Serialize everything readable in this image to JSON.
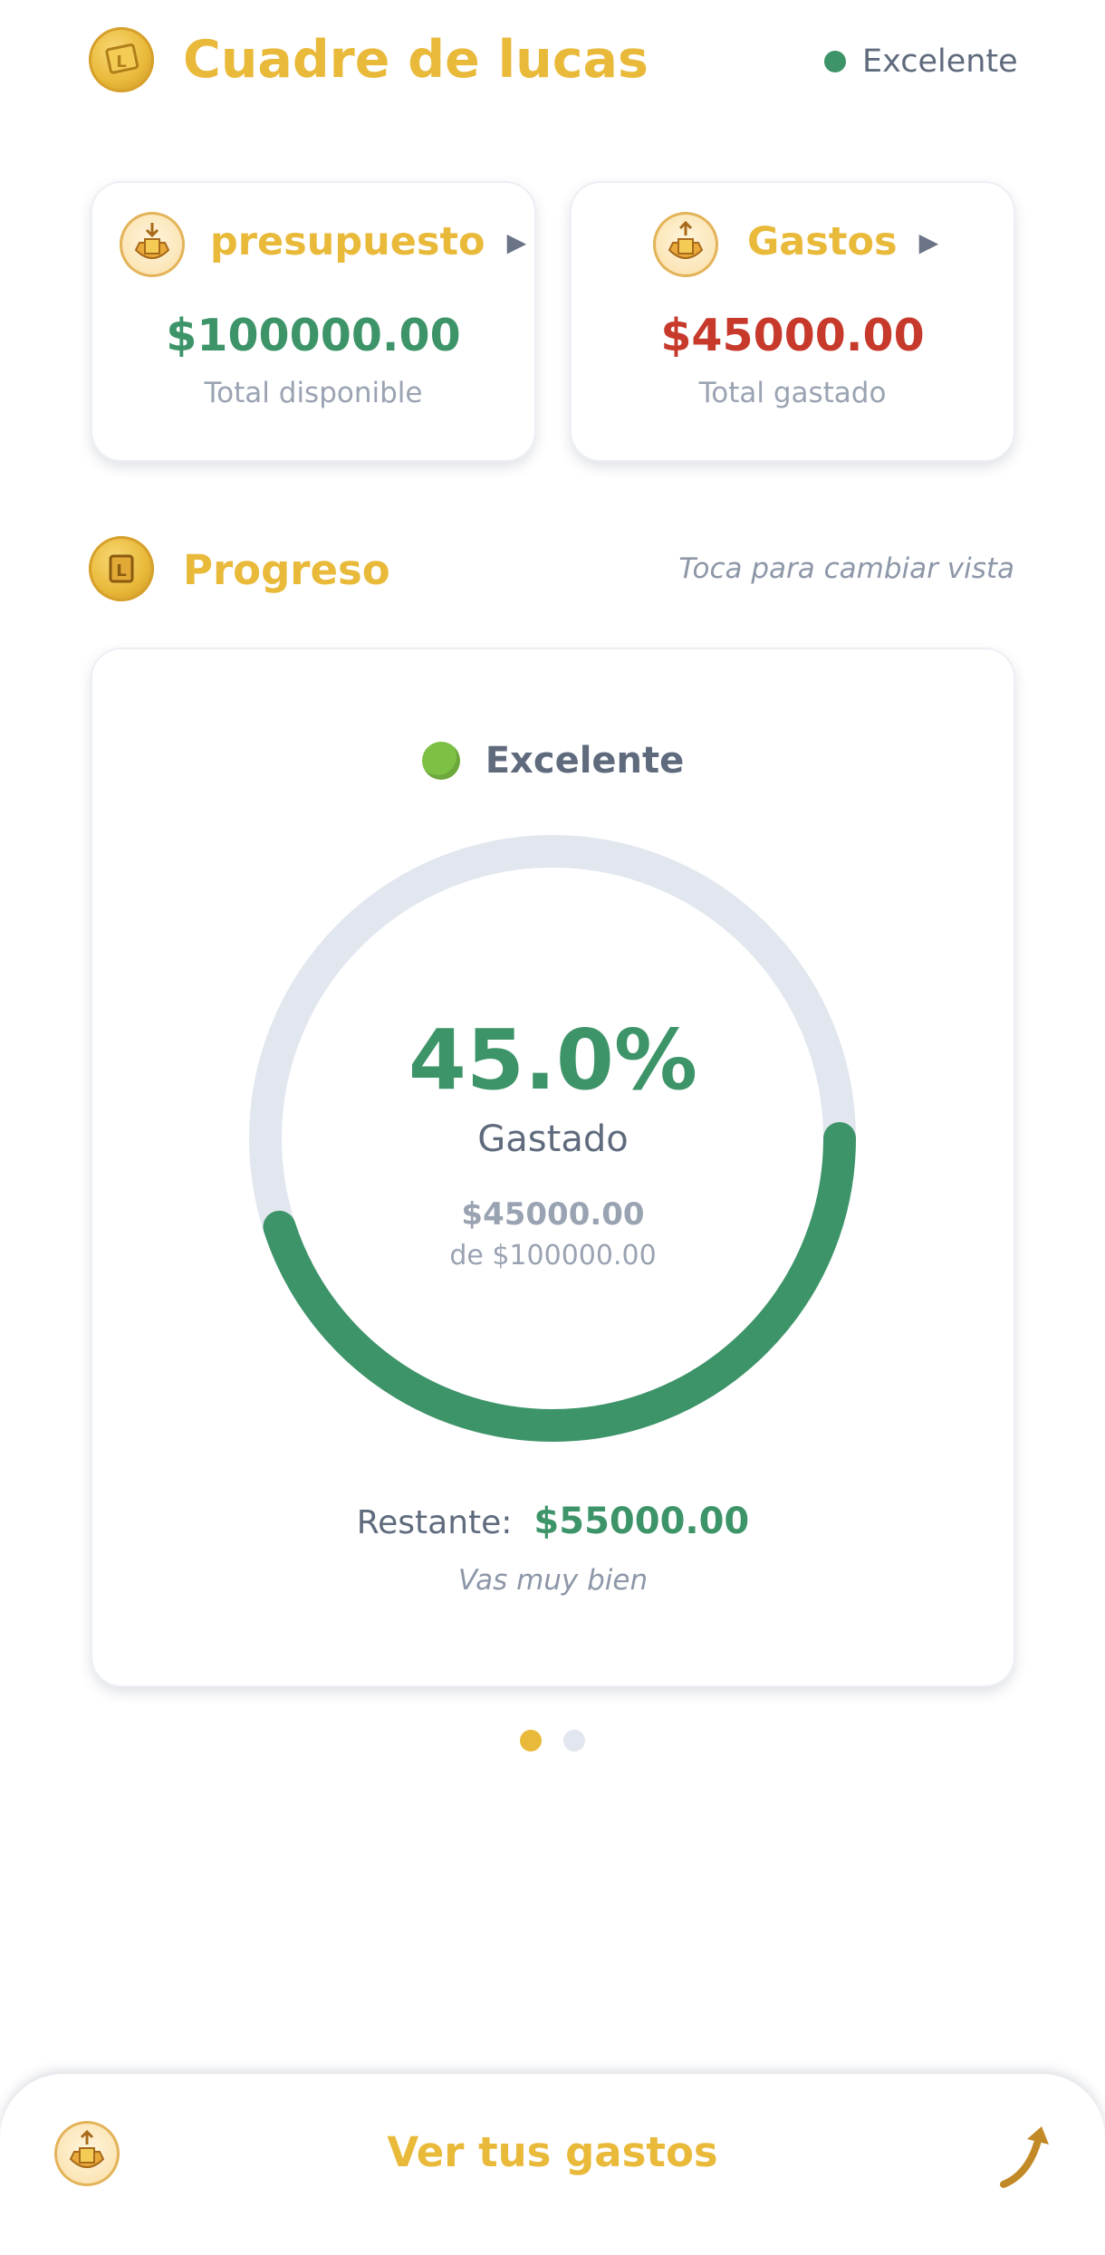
{
  "header": {
    "title": "Cuadre de lucas",
    "status_label": "Excelente",
    "status_color": "#3d9469",
    "logo_icon": "coin-ticket-icon"
  },
  "cards": {
    "budget": {
      "title": "presupuesto",
      "amount": "$100000.00",
      "caption": "Total disponible",
      "amount_color": "#3d9469",
      "icon": "bag-coin-in-icon"
    },
    "expenses": {
      "title": "Gastos",
      "amount": "$45000.00",
      "caption": "Total gastado",
      "amount_color": "#c6392b",
      "icon": "bag-coin-out-icon"
    }
  },
  "progress": {
    "title": "Progreso",
    "hint": "Toca para cambiar vista",
    "status_label": "Excelente",
    "status_dot_color": "#7cc044",
    "percent_label": "45.0%",
    "percent_value": 0.45,
    "caption": "Gastado",
    "spent": "$45000.00",
    "of_total": "de $100000.00",
    "remaining_label": "Restante:",
    "remaining_value": "$55000.00",
    "message": "Vas muy bien",
    "ring_color": "#3d9469",
    "track_color": "#e2e7ef"
  },
  "pager": {
    "pages": 2,
    "active": 0
  },
  "bottom_bar": {
    "label": "Ver tus gastos",
    "icon": "bag-coin-out-icon",
    "arrow_icon": "curved-arrow-up-icon"
  },
  "colors": {
    "accent": "#e9b93a",
    "green": "#3d9469",
    "red": "#c6392b"
  }
}
